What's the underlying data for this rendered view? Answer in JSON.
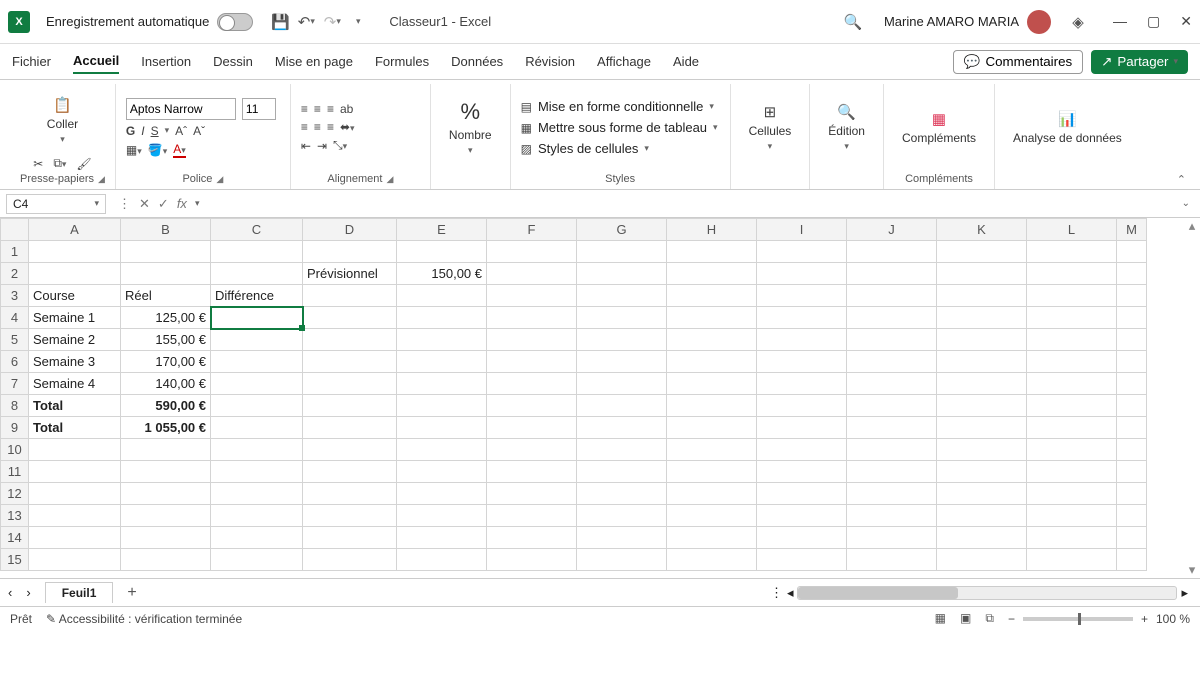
{
  "titlebar": {
    "app_icon_text": "X",
    "autosave_label": "Enregistrement automatique",
    "document_title": "Classeur1 - Excel",
    "user_name": "Marine AMARO MARIA"
  },
  "tabs": {
    "items": [
      "Fichier",
      "Accueil",
      "Insertion",
      "Dessin",
      "Mise en page",
      "Formules",
      "Données",
      "Révision",
      "Affichage",
      "Aide"
    ],
    "active_index": 1,
    "comments_label": "Commentaires",
    "share_label": "Partager"
  },
  "ribbon": {
    "clipboard": {
      "paste": "Coller",
      "group": "Presse-papiers"
    },
    "font": {
      "name": "Aptos Narrow",
      "size": "11",
      "bold": "G",
      "italic": "I",
      "underline": "S",
      "group": "Police"
    },
    "alignment": {
      "wrap": "ab",
      "group": "Alignement"
    },
    "number": {
      "label": "Nombre",
      "percent": "%"
    },
    "styles": {
      "conditional": "Mise en forme conditionnelle",
      "table": "Mettre sous forme de tableau",
      "cell": "Styles de cellules",
      "group": "Styles"
    },
    "cells": "Cellules",
    "editing": "Édition",
    "addins": {
      "label": "Compléments",
      "group": "Compléments"
    },
    "analyze": "Analyse de données"
  },
  "formula_bar": {
    "name_box": "C4",
    "fx": "fx"
  },
  "columns": [
    "A",
    "B",
    "C",
    "D",
    "E",
    "F",
    "G",
    "H",
    "I",
    "J",
    "K",
    "L",
    "M"
  ],
  "rows": [
    1,
    2,
    3,
    4,
    5,
    6,
    7,
    8,
    9,
    10,
    11,
    12,
    13,
    14,
    15
  ],
  "cells": {
    "D2": "Prévisionnel",
    "E2": "150,00 €",
    "A3": "Course",
    "B3": "Réel",
    "C3": "Différence",
    "A4": "Semaine 1",
    "B4": "125,00 €",
    "A5": "Semaine 2",
    "B5": "155,00 €",
    "A6": "Semaine 3",
    "B6": "170,00 €",
    "A7": "Semaine 4",
    "B7": "140,00 €",
    "A8": "Total",
    "B8": "590,00 €",
    "A9": "Total",
    "B9": "1 055,00 €"
  },
  "selected_cell": "C4",
  "sheet_tabs": {
    "nav_prev": "‹",
    "nav_next": "›",
    "active": "Feuil1",
    "add": "+"
  },
  "status": {
    "ready": "Prêt",
    "accessibility": "Accessibilité : vérification terminée",
    "zoom_minus": "−",
    "zoom_plus": "+",
    "zoom": "100 %"
  }
}
